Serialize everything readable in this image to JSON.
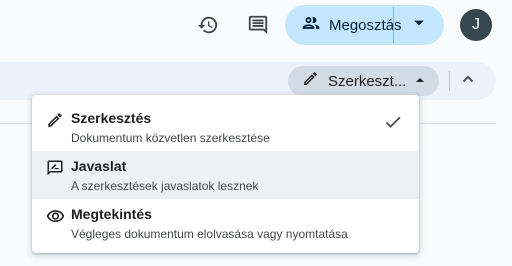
{
  "header": {
    "history_icon": "history-icon",
    "comments_icon": "comments-icon",
    "share": {
      "label": "Megosztás",
      "icon": "people-icon",
      "dropdown_icon": "caret-down-icon"
    },
    "avatar_initial": "J"
  },
  "toolbar": {
    "mode_label": "Szerkeszt...",
    "mode_icon": "pencil-icon",
    "mode_caret_icon": "caret-up-icon",
    "collapse_icon": "chevron-up-icon"
  },
  "mode_menu": {
    "items": [
      {
        "title": "Szerkesztés",
        "description": "Dokumentum közvetlen szerkesztése",
        "icon": "pencil-icon",
        "selected": true
      },
      {
        "title": "Javaslat",
        "description": "A szerkesztések javaslatok lesznek",
        "icon": "suggest-edit-icon",
        "selected": false
      },
      {
        "title": "Megtekintés",
        "description": "Végleges dokumentum elolvasása vagy nyomtatása",
        "icon": "eye-icon",
        "selected": false
      }
    ]
  },
  "colors": {
    "share_bg": "#c2e7ff",
    "toolbar_bg": "#edf2fa",
    "mode_pill_bg": "#d3dbe5",
    "avatar_bg": "#37474f",
    "menu_highlight": "#eef1f4"
  }
}
